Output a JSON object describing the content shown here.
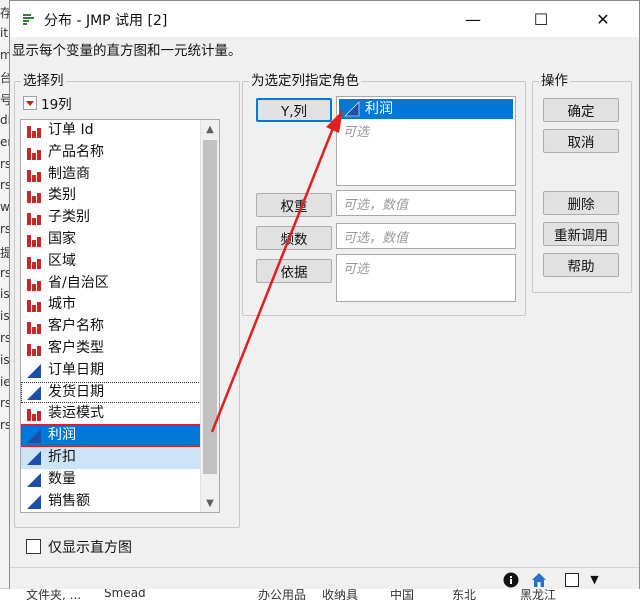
{
  "window": {
    "title": "分布 - JMP 试用 [2]",
    "subtitle": "显示每个变量的直方图和一元统计量。",
    "controls": {
      "minimize": "—",
      "maximize": "☐",
      "close": "✕"
    }
  },
  "select_columns": {
    "group_title": "选择列",
    "count_label": "19列",
    "items": [
      {
        "label": "订单 Id",
        "type": "nominal"
      },
      {
        "label": "产品名称",
        "type": "nominal"
      },
      {
        "label": "制造商",
        "type": "nominal"
      },
      {
        "label": "类别",
        "type": "nominal"
      },
      {
        "label": "子类别",
        "type": "nominal"
      },
      {
        "label": "国家",
        "type": "nominal"
      },
      {
        "label": "区域",
        "type": "nominal"
      },
      {
        "label": "省/自治区",
        "type": "nominal"
      },
      {
        "label": "城市",
        "type": "nominal"
      },
      {
        "label": "客户名称",
        "type": "nominal"
      },
      {
        "label": "客户类型",
        "type": "nominal"
      },
      {
        "label": "订单日期",
        "type": "continuous"
      },
      {
        "label": "发货日期",
        "type": "continuous",
        "state": "focus"
      },
      {
        "label": "装运模式",
        "type": "nominal"
      },
      {
        "label": "利润",
        "type": "continuous",
        "state": "selected"
      },
      {
        "label": "折扣",
        "type": "continuous",
        "state": "hilite"
      },
      {
        "label": "数量",
        "type": "continuous"
      },
      {
        "label": "销售额",
        "type": "continuous"
      }
    ]
  },
  "cast_roles": {
    "group_title": "为选定列指定角色",
    "y": {
      "button": "Y,列",
      "assigned": "利润",
      "placeholder": "可选"
    },
    "weight": {
      "button": "权重",
      "placeholder": "可选，数值"
    },
    "freq": {
      "button": "频数",
      "placeholder": "可选，数值"
    },
    "by": {
      "button": "依据",
      "placeholder": "可选"
    }
  },
  "actions": {
    "group_title": "操作",
    "ok": "确定",
    "cancel": "取消",
    "remove": "删除",
    "recall": "重新调用",
    "help": "帮助"
  },
  "options": {
    "histogram_only": "仅显示直方图",
    "histogram_only_checked": false
  },
  "background": {
    "row_fragments": [
      "存",
      "it",
      "m",
      "台",
      "号",
      "di",
      "en",
      "rs",
      "rs",
      "w",
      "rs",
      "提",
      "rs",
      "is",
      "is",
      "rs",
      "is",
      "ie",
      "rs",
      "rs"
    ],
    "bottom_cells": [
      "文件夹, ...",
      "Smead",
      "办公用品",
      "收纳具",
      "中国",
      "东北",
      "黑龙江"
    ]
  },
  "colors": {
    "accent": "#0078d7",
    "annotation": "#e02020",
    "nominal_icon": "#c62828",
    "continuous_icon": "#1e4fa8"
  }
}
